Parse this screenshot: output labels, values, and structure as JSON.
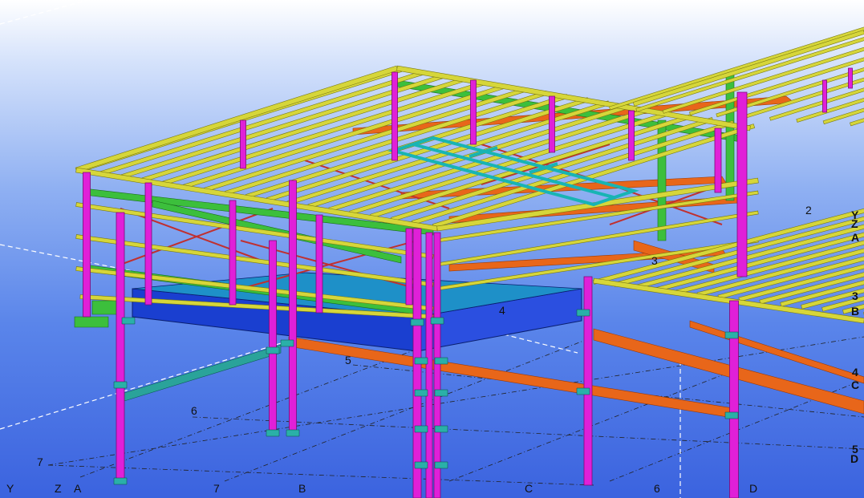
{
  "viewport": {
    "background_top": "#ffffff",
    "background_bottom": "#3b63df"
  },
  "colors": {
    "column": "#e020d8",
    "purlin": "#d6d63a",
    "rafter": "#3cbf3c",
    "brace": "#c03030",
    "orange_beam": "#e8661a",
    "blue_beam": "#1a3fd0",
    "cyan_frame": "#18b4b4",
    "teal_bracing": "#2aa39a"
  },
  "grid_labels": {
    "near_Y": "Y",
    "near_Z": "Z",
    "near_A": "A",
    "near_7_left": "7",
    "near_7_mid": "7",
    "near_6_left": "6",
    "near_5": "5",
    "near_4": "4",
    "near_3": "3",
    "near_2": "2",
    "near_B": "B",
    "near_C": "C",
    "near_6_right": "6",
    "near_D": "D",
    "right_Y": "Y",
    "right_Z": "Z",
    "right_A": "A",
    "right_3": "3",
    "right_B": "B",
    "right_4": "4",
    "right_C": "C",
    "right_5": "5",
    "right_D": "D"
  }
}
